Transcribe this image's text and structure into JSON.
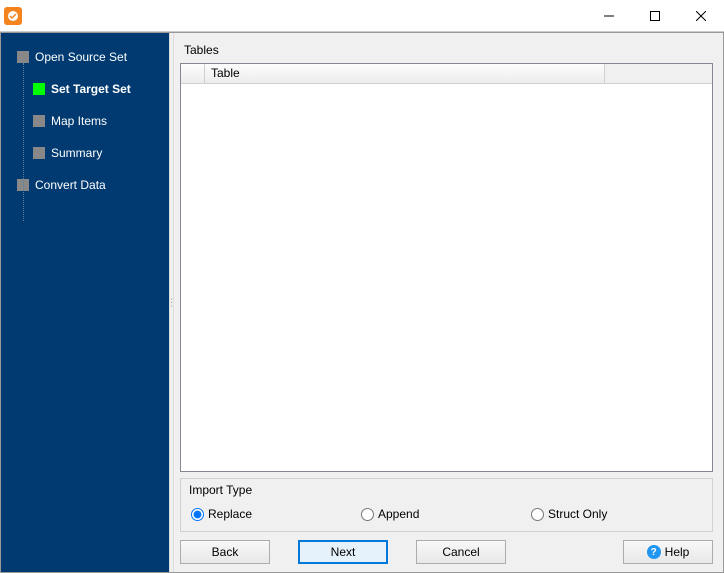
{
  "window": {
    "title": ""
  },
  "sidebar": {
    "items": [
      {
        "label": "Open Source Set",
        "level": 0,
        "active": false,
        "bold": false
      },
      {
        "label": "Set Target Set",
        "level": 1,
        "active": true,
        "bold": true
      },
      {
        "label": "Map Items",
        "level": 1,
        "active": false,
        "bold": false
      },
      {
        "label": "Summary",
        "level": 1,
        "active": false,
        "bold": false
      },
      {
        "label": "Convert Data",
        "level": 0,
        "active": false,
        "bold": false
      }
    ]
  },
  "main": {
    "tables_label": "Tables",
    "grid": {
      "columns": [
        {
          "key": "select",
          "label": ""
        },
        {
          "key": "table",
          "label": "Table"
        }
      ],
      "rows": []
    },
    "import_type": {
      "label": "Import Type",
      "options": [
        {
          "value": "replace",
          "label": "Replace",
          "checked": true
        },
        {
          "value": "append",
          "label": "Append",
          "checked": false
        },
        {
          "value": "struct_only",
          "label": "Struct Only",
          "checked": false
        }
      ]
    },
    "buttons": {
      "back": "Back",
      "next": "Next",
      "cancel": "Cancel",
      "help": "Help"
    }
  }
}
